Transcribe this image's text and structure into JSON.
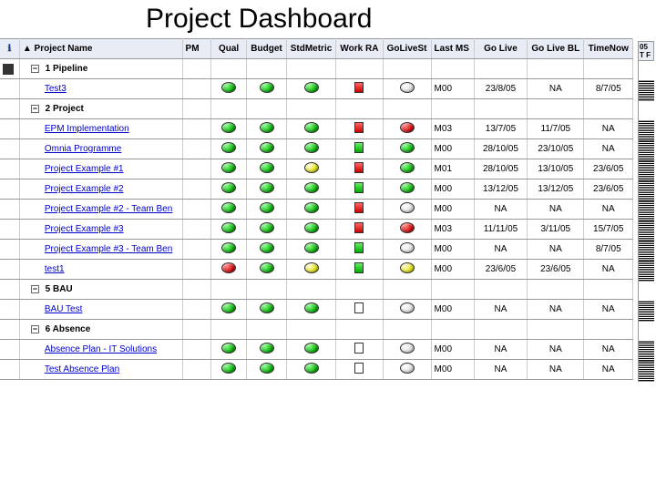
{
  "title": "Project Dashboard",
  "iconGlyph": "ℹ",
  "expGlyph": "−",
  "columns": {
    "name": "Project Name",
    "pm": "PM",
    "qual": "Qual",
    "budget": "Budget",
    "stdm": "StdMetric",
    "workra": "Work RA",
    "golives": "GoLiveSt",
    "lastms": "Last MS",
    "golive": "Go Live",
    "golivebl": "Go Live BL",
    "timenow": "TimeNow"
  },
  "groups": [
    {
      "label": "1 Pipeline",
      "rows": [
        {
          "name": "Test3",
          "qual": "green",
          "budget": "green",
          "stdm": "green",
          "workra": "red",
          "golives": "white",
          "lastms": "M00",
          "golive": "23/8/05",
          "golivebl": "NA",
          "timenow": "8/7/05"
        }
      ]
    },
    {
      "label": "2 Project",
      "rows": [
        {
          "name": "EPM Implementation",
          "qual": "green",
          "budget": "green",
          "stdm": "green",
          "workra": "red",
          "golives": "red",
          "lastms": "M03",
          "golive": "13/7/05",
          "golivebl": "11/7/05",
          "timenow": "NA"
        },
        {
          "name": "Omnia Programme",
          "qual": "green",
          "budget": "green",
          "stdm": "green",
          "workra": "green",
          "golives": "green",
          "lastms": "M00",
          "golive": "28/10/05",
          "golivebl": "23/10/05",
          "timenow": "NA"
        },
        {
          "name": "Project Example #1",
          "qual": "green",
          "budget": "green",
          "stdm": "yellow",
          "workra": "red",
          "golives": "green",
          "lastms": "M01",
          "golive": "28/10/05",
          "golivebl": "13/10/05",
          "timenow": "23/6/05"
        },
        {
          "name": "Project Example #2",
          "qual": "green",
          "budget": "green",
          "stdm": "green",
          "workra": "green",
          "golives": "green",
          "lastms": "M00",
          "golive": "13/12/05",
          "golivebl": "13/12/05",
          "timenow": "23/6/05"
        },
        {
          "name": "Project Example #2 - Team Ben",
          "qual": "green",
          "budget": "green",
          "stdm": "green",
          "workra": "red",
          "golives": "white",
          "lastms": "M00",
          "golive": "NA",
          "golivebl": "NA",
          "timenow": "NA"
        },
        {
          "name": "Project Example #3",
          "qual": "green",
          "budget": "green",
          "stdm": "green",
          "workra": "red",
          "golives": "red",
          "lastms": "M03",
          "golive": "11/11/05",
          "golivebl": "3/11/05",
          "timenow": "15/7/05"
        },
        {
          "name": "Project Example #3 - Team Ben",
          "qual": "green",
          "budget": "green",
          "stdm": "green",
          "workra": "green",
          "golives": "white",
          "lastms": "M00",
          "golive": "NA",
          "golivebl": "NA",
          "timenow": "8/7/05"
        },
        {
          "name": "test1",
          "qual": "red",
          "budget": "green",
          "stdm": "yellow",
          "workra": "green",
          "golives": "yellow",
          "lastms": "M00",
          "golive": "23/6/05",
          "golivebl": "23/6/05",
          "timenow": "NA"
        }
      ]
    },
    {
      "label": "5 BAU",
      "rows": [
        {
          "name": "BAU Test",
          "qual": "green",
          "budget": "green",
          "stdm": "green",
          "workra": "white",
          "golives": "white",
          "lastms": "M00",
          "golive": "NA",
          "golivebl": "NA",
          "timenow": "NA"
        }
      ]
    },
    {
      "label": "6 Absence",
      "rows": [
        {
          "name": "Absence Plan - IT Solutions",
          "qual": "green",
          "budget": "green",
          "stdm": "green",
          "workra": "white",
          "golives": "white",
          "lastms": "M00",
          "golive": "NA",
          "golivebl": "NA",
          "timenow": "NA"
        },
        {
          "name": "Test Absence Plan",
          "qual": "green",
          "budget": "green",
          "stdm": "green",
          "workra": "white",
          "golives": "white",
          "lastms": "M00",
          "golive": "NA",
          "golivebl": "NA",
          "timenow": "NA"
        }
      ]
    }
  ],
  "rightStrip": {
    "head1": "05",
    "head2": "T F"
  }
}
